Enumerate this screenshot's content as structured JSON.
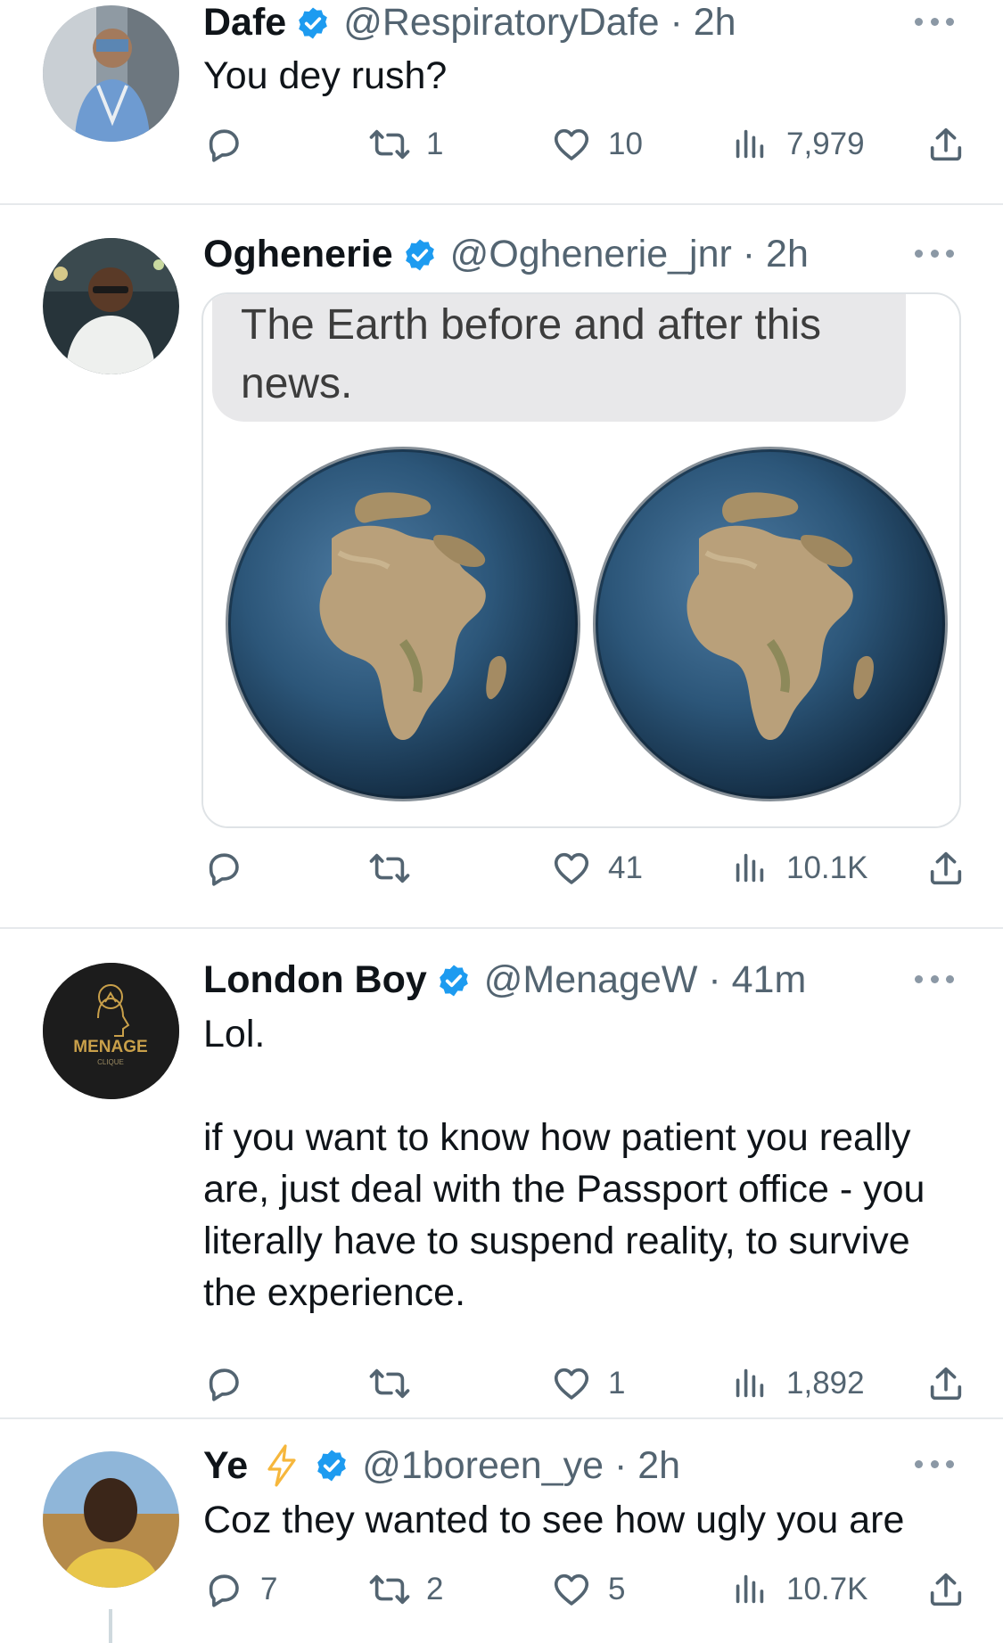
{
  "tweets": [
    {
      "name": "Dafe",
      "handle": "@RespiratoryDafe · 2h",
      "text": "You dey rush?",
      "replies": "",
      "retweets": "1",
      "likes": "10",
      "views": "7,979"
    },
    {
      "name": "Oghenerie",
      "handle": "@Oghenerie_jnr · 2h",
      "media_caption": "The Earth before and after this news.",
      "replies": "",
      "retweets": "",
      "likes": "41",
      "views": "10.1K"
    },
    {
      "name": "London Boy",
      "handle": "@MenageW · 41m",
      "text": "Lol.\n\nif you want to know how patient you really are, just deal with the Passport office - you literally have to suspend reality, to survive the experience.",
      "avatar_text": "MENAGE",
      "avatar_subtext": "CLIQUE",
      "replies": "",
      "retweets": "",
      "likes": "1",
      "views": "1,892"
    },
    {
      "name": "Ye",
      "handle": "@1boreen_ye · 2h",
      "text": "Coz they wanted to see how ugly you are",
      "replies": "7",
      "retweets": "2",
      "likes": "5",
      "views": "10.7K"
    }
  ],
  "colors": {
    "verified": "#1d9bf0",
    "secondary_text": "#536471",
    "lightning": "#f6b73c"
  },
  "icons": [
    "reply-icon",
    "retweet-icon",
    "like-icon",
    "views-icon",
    "share-icon",
    "verified-badge-icon",
    "more-options-icon",
    "lightning-icon"
  ]
}
